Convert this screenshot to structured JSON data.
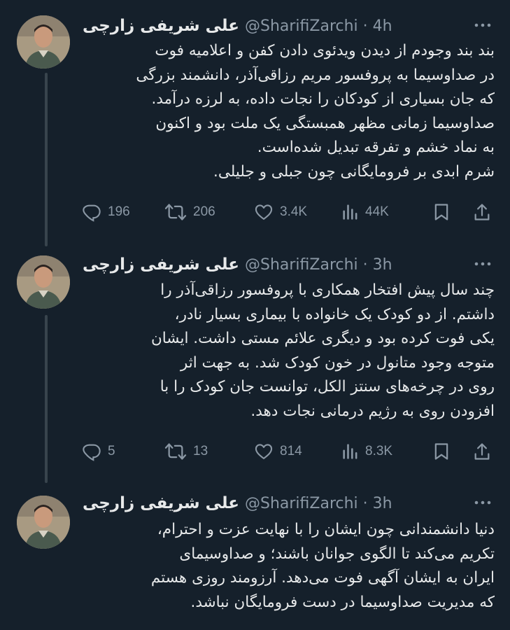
{
  "tweets": [
    {
      "name": "علی شریفی زارچی",
      "handle": "@SharifiZarchi",
      "time": "4h",
      "text": "بند بند وجودم از دیدن ویدئوی دادن کفن و اعلامیه فوت\nدر صداوسیما به پروفسور مریم رزاقی‌آذر، دانشمند بزرگی\nکه جان بسیاری از کودکان را نجات داده، به لرزه درآمد.\nصداوسیما زمانی مظهر همبستگی یک ملت بود و اکنون\nبه نماد خشم و تفرقه تبدیل شده‌است.\nشرم ابدی بر فرومایگانی چون جبلی و جلیلی.",
      "replies": "196",
      "retweets": "206",
      "likes": "3.4K",
      "views": "44K"
    },
    {
      "name": "علی شریفی زارچی",
      "handle": "@SharifiZarchi",
      "time": "3h",
      "text": "چند سال پیش افتخار همکاری با پروفسور رزاقی‌آذر را\nداشتم. از دو کودک یک خانواده با بیماری بسیار نادر،\nیکی فوت کرده بود و دیگری علائم مستی داشت. ایشان\nمتوجه وجود متانول در خون کودک شد. به جهت اثر\nروی در چرخه‌های سنتز الکل، توانست جان کودک را با\nافزودن روی به رژیم درمانی نجات دهد.",
      "replies": "5",
      "retweets": "13",
      "likes": "814",
      "views": "8.3K"
    },
    {
      "name": "علی شریفی زارچی",
      "handle": "@SharifiZarchi",
      "time": "3h",
      "text": "دنیا دانشمندانی چون ایشان را با نهایت عزت و احترام،\nتکریم می‌کند تا الگوی جوانان باشند؛ و صداوسیمای\nایران به ایشان آگهی فوت می‌دهد. آرزومند روزی هستم\nکه مدیریت صداوسیما در دست فرومایگان نباشد."
    }
  ],
  "icons": {
    "reply": "reply-icon",
    "retweet": "retweet-icon",
    "like": "heart-icon",
    "views": "views-icon",
    "bookmark": "bookmark-icon",
    "share": "share-icon",
    "more": "more-icon"
  },
  "colors": {
    "background": "#15202b",
    "text": "#e7e9ea",
    "secondary": "#8b98a5",
    "thread_line": "#38444d"
  }
}
